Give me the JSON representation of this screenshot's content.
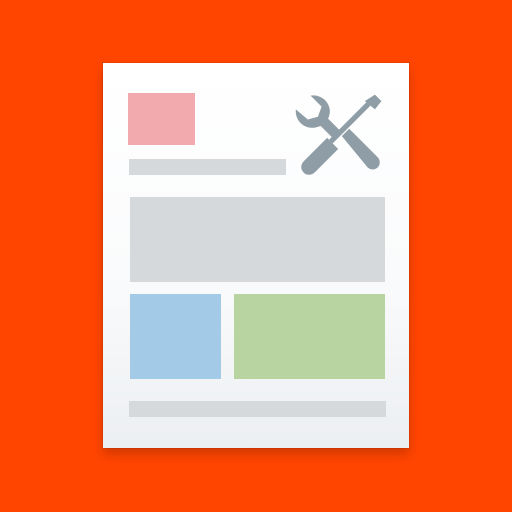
{
  "colors": {
    "background": "#ff4500",
    "page": "#f7f9fa",
    "logo_block": "#f2aaae",
    "neutral_block": "#d5d9dc",
    "left_block": "#a3cbe8",
    "right_block": "#b8d4a0",
    "tools_icon": "#8f9da6"
  },
  "icons": {
    "tools": "wrench-and-screwdriver-icon"
  }
}
